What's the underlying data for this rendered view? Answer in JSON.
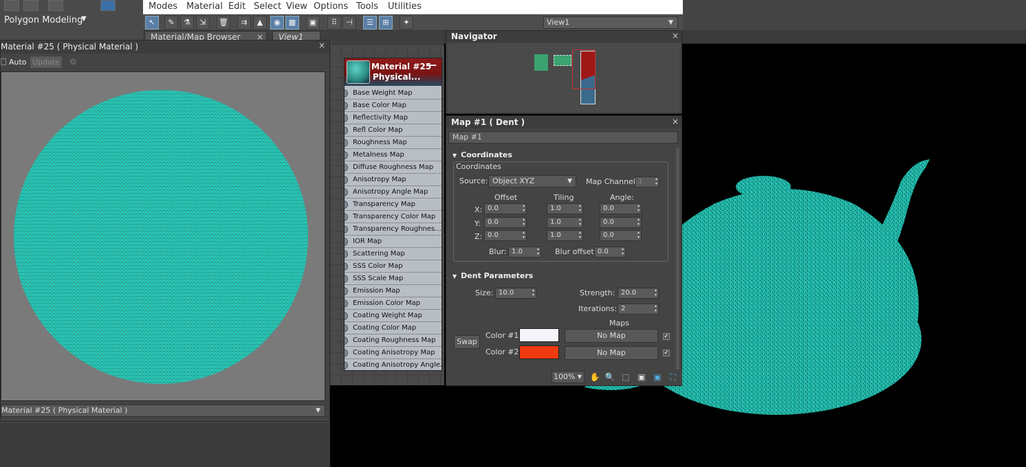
{
  "ribbon": {
    "mode_label": "Polygon Modeling"
  },
  "menubar": {
    "items": [
      "Modes",
      "Material",
      "Edit",
      "Select",
      "View",
      "Options",
      "Tools",
      "Utilities"
    ]
  },
  "toolbar": {
    "view_dropdown": "View1"
  },
  "tabs": {
    "browser": "Material/Map Browser",
    "view": "View1"
  },
  "material_editor": {
    "title": "Material #25  ( Physical Material )",
    "auto_label": "Auto",
    "update_label": "Update",
    "dropdown_value": "Material #25  ( Physical Material )"
  },
  "node": {
    "title_line1": "Material #25",
    "title_line2": "Physical...",
    "slots": [
      "Base Weight Map",
      "Base Color Map",
      "Reflectivity Map",
      "Refl Color Map",
      "Roughness Map",
      "Metalness Map",
      "Diffuse Roughness Map",
      "Anisotropy Map",
      "Anisotropy Angle Map",
      "Transparency Map",
      "Transparency Color Map",
      "Transparency Roughnes...",
      "IOR Map",
      "Scattering Map",
      "SSS Color Map",
      "SSS Scale Map",
      "Emission Map",
      "Emission Color Map",
      "Coating Weight Map",
      "Coating Color Map",
      "Coating Roughness Map",
      "Coating Anisotropy Map",
      "Coating Anisotropy Angle..."
    ]
  },
  "navigator": {
    "title": "Navigator"
  },
  "map_panel": {
    "title": "Map #1  ( Dent )",
    "name_field": "Map #1",
    "coordinates": {
      "heading": "Coordinates",
      "group_label": "Coordinates",
      "source_label": "Source:",
      "source_value": "Object XYZ",
      "map_channel_label": "Map Channel:",
      "map_channel_value": "1",
      "col_offset": "Offset",
      "col_tiling": "Tiling",
      "col_angle": "Angle:",
      "x_label": "X:",
      "y_label": "Y:",
      "z_label": "Z:",
      "offset": [
        "0.0",
        "0.0",
        "0.0"
      ],
      "tiling": [
        "1.0",
        "1.0",
        "1.0"
      ],
      "angle": [
        "0.0",
        "0.0",
        "0.0"
      ],
      "blur_label": "Blur:",
      "blur_value": "1.0",
      "blur_offset_label": "Blur offset:",
      "blur_offset_value": "0.0"
    },
    "dent": {
      "heading": "Dent Parameters",
      "size_label": "Size:",
      "size_value": "10.0",
      "strength_label": "Strength:",
      "strength_value": "20.0",
      "iterations_label": "Iterations:",
      "iterations_value": "2",
      "maps_label": "Maps",
      "swap_label": "Swap",
      "color1_label": "Color #1",
      "color2_label": "Color #2",
      "color1": "#f4f4fb",
      "color2": "#f03a10",
      "no_map_1": "No Map",
      "no_map_2": "No Map"
    }
  },
  "view_controls": {
    "zoom": "100%"
  }
}
